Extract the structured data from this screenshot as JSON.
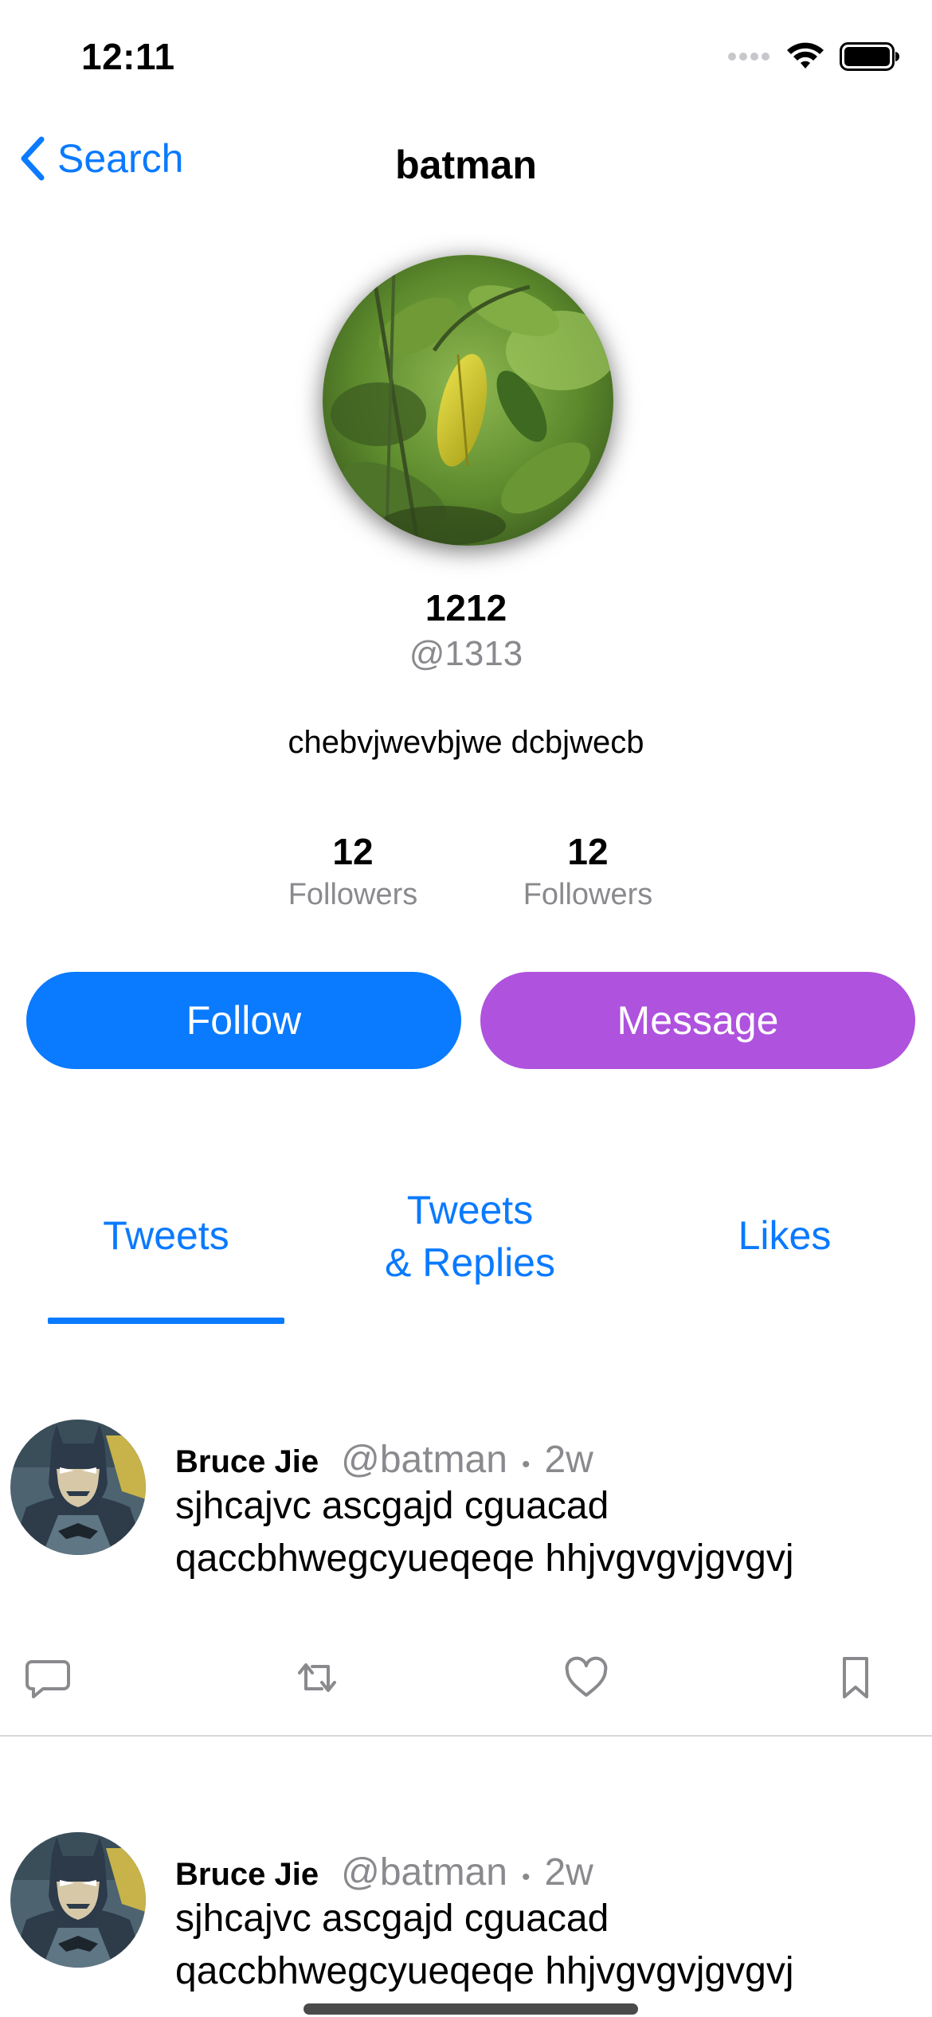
{
  "status_bar": {
    "time": "12:11"
  },
  "nav": {
    "back_label": "Search",
    "title": "batman"
  },
  "profile": {
    "name": "1212",
    "handle": "@1313",
    "bio": "chebvjwevbjwe dcbjwecb",
    "stats": [
      {
        "count": "12",
        "label": "Followers"
      },
      {
        "count": "12",
        "label": "Followers"
      }
    ],
    "follow_label": "Follow",
    "message_label": "Message"
  },
  "tabs": [
    {
      "label": "Tweets",
      "selected": true
    },
    {
      "label_line1": "Tweets",
      "label_line2": "& Replies",
      "selected": false
    },
    {
      "label": "Likes",
      "selected": false
    }
  ],
  "tweets": [
    {
      "name": "Bruce Jie",
      "handle": "@batman",
      "separator": "•",
      "time": "2w",
      "text_line1": "sjhcajvc ascgajd cguacad",
      "text_line2": "qaccbhwegcyueqeqe hhjvgvgvjgvgvj"
    },
    {
      "name": "Bruce Jie",
      "handle": "@batman",
      "separator": "•",
      "time": "2w",
      "text_line1": "sjhcajvc ascgajd cguacad",
      "text_line2": "qaccbhwegcyueqeqe hhjvgvgvjgvgvj"
    }
  ],
  "colors": {
    "accent": "#0a7aff",
    "message_button": "#af52de",
    "secondary_text": "#8a8a8e"
  },
  "icons": {
    "back": "chevron-left-icon",
    "reply": "comment-icon",
    "retweet": "retweet-icon",
    "like": "heart-icon",
    "bookmark": "bookmark-icon"
  }
}
